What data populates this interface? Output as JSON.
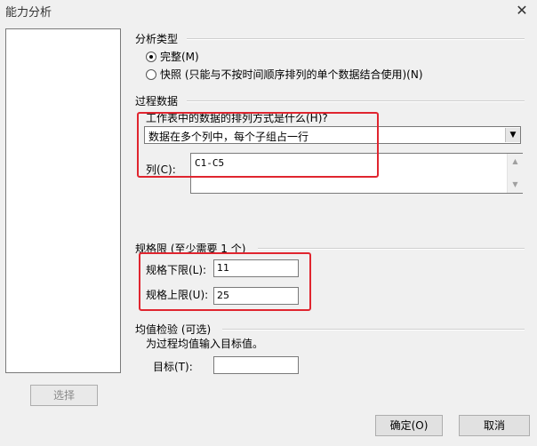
{
  "window": {
    "title": "能力分析",
    "close_glyph": "✕"
  },
  "left_panel": {
    "select_button": "选择"
  },
  "analysis_type": {
    "heading": "分析类型",
    "options": [
      {
        "label": "完整(M)",
        "selected": true
      },
      {
        "label": "快照 (只能与不按时间顺序排列的单个数据结合使用)(N)",
        "selected": false
      }
    ]
  },
  "process_data": {
    "heading": "过程数据",
    "arrangement_prompt": "工作表中的数据的排列方式是什么(H)?",
    "arrangement_value": "数据在多个列中，每个子组占一行",
    "columns_label": "列(C):",
    "columns_value": "C1-C5"
  },
  "spec_limits": {
    "heading": "规格限 (至少需要 1 个)",
    "lower_label": "规格下限(L):",
    "lower_value": "11",
    "upper_label": "规格上限(U):",
    "upper_value": "25"
  },
  "mean_test": {
    "heading": "均值检验 (可选)",
    "instruction": "为过程均值输入目标值。",
    "target_label": "目标(T):",
    "target_value": ""
  },
  "buttons": {
    "ok": "确定(O)",
    "cancel": "取消"
  },
  "colors": {
    "highlight": "#e0252f",
    "background": "#f0f0f0"
  }
}
